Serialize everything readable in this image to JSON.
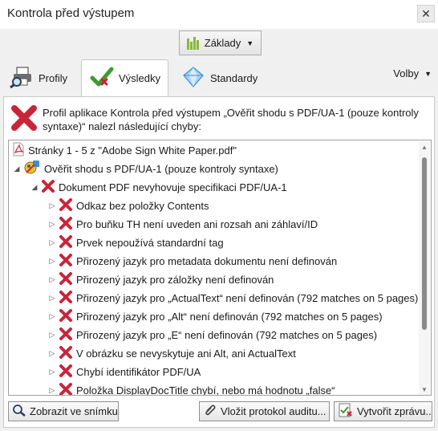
{
  "window": {
    "title": "Kontrola před výstupem",
    "close": "✕"
  },
  "profile_button": {
    "label": "Základy"
  },
  "tabs": [
    {
      "label": "Profily",
      "icon": "printer-magnifier-icon"
    },
    {
      "label": "Výsledky",
      "icon": "checkmark-icon",
      "active": true
    },
    {
      "label": "Standardy",
      "icon": "diamond-icon"
    }
  ],
  "options": {
    "label": "Volby"
  },
  "summary": {
    "message": "Profil aplikace Kontrola před výstupem „Ověřit shodu s PDF/UA-1 (pouze kontroly syntaxe)“ nalezl následující chyby:"
  },
  "tree": {
    "root": "Stránky 1 - 5 z \"Adobe Sign White Paper.pdf\"",
    "profile": "Ověřit shodu s PDF/UA-1 (pouze kontroly syntaxe)",
    "group": "Dokument PDF nevyhovuje specifikaci PDF/UA-1",
    "errors": [
      "Odkaz bez položky Contents",
      "Pro buňku TH není uveden ani rozsah ani záhlaví/ID",
      "Prvek nepoužívá standardní tag",
      "Přirozený jazyk pro metadata dokumentu není definován",
      "Přirozený jazyk pro záložky není definován",
      "Přirozený jazyk pro „ActualText“ není definován (792 matches on 5 pages)",
      "Přirozený jazyk pro „Alt“ není definován (792 matches on 5 pages)",
      "Přirozený jazyk pro „E“ není definován (792 matches on 5 pages)",
      "V obrázku se nevyskytuje ani Alt, ani ActualText",
      "Chybí identifikátor PDF/UA",
      "Položka DisplayDocTitle chybí, nebo má hodnotu „false“"
    ]
  },
  "buttons": {
    "show": "Zobrazit ve snímku",
    "audit": "Vložit protokol auditu...",
    "report": "Vytvořit zprávu..."
  },
  "colors": {
    "error_red": "#c9253a",
    "check_green": "#3f9a2f",
    "accent_blue": "#3b8ed8"
  }
}
